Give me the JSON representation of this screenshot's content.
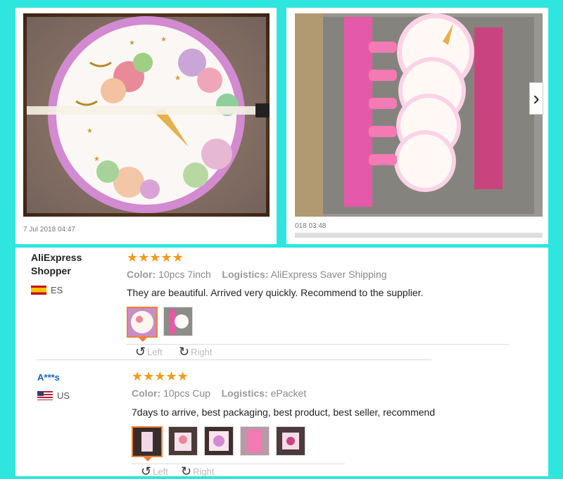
{
  "cards": [
    {
      "timestamp": "7 Jul 2018 04:47"
    },
    {
      "timestamp": "018 03:48"
    }
  ],
  "reviews": [
    {
      "name": "AliExpress Shopper",
      "country": "ES",
      "rating": 5,
      "color_label": "Color:",
      "color_value": "10pcs 7inch",
      "logistics_label": "Logistics:",
      "logistics_value": "AliExpress Saver Shipping",
      "text": "They are beautiful. Arrived very quickly. Recommend to the supplier.",
      "rotate_left": "Left",
      "rotate_right": "Right"
    },
    {
      "name": "A***s",
      "country": "US",
      "rating": 5,
      "color_label": "Color:",
      "color_value": "10pcs Cup",
      "logistics_label": "Logistics:",
      "logistics_value": "ePacket",
      "text": "7days to arrive, best packaging, best product, best seller, recommend",
      "rotate_left": "Left",
      "rotate_right": "Right"
    }
  ],
  "icons": {
    "star": "★",
    "next": "›",
    "rotate_left": "↺",
    "rotate_right": "↻"
  },
  "colors": {
    "background": "#2ee6de",
    "star": "#f39a1c",
    "accent": "#e8823a",
    "name_blue": "#1566b5"
  }
}
